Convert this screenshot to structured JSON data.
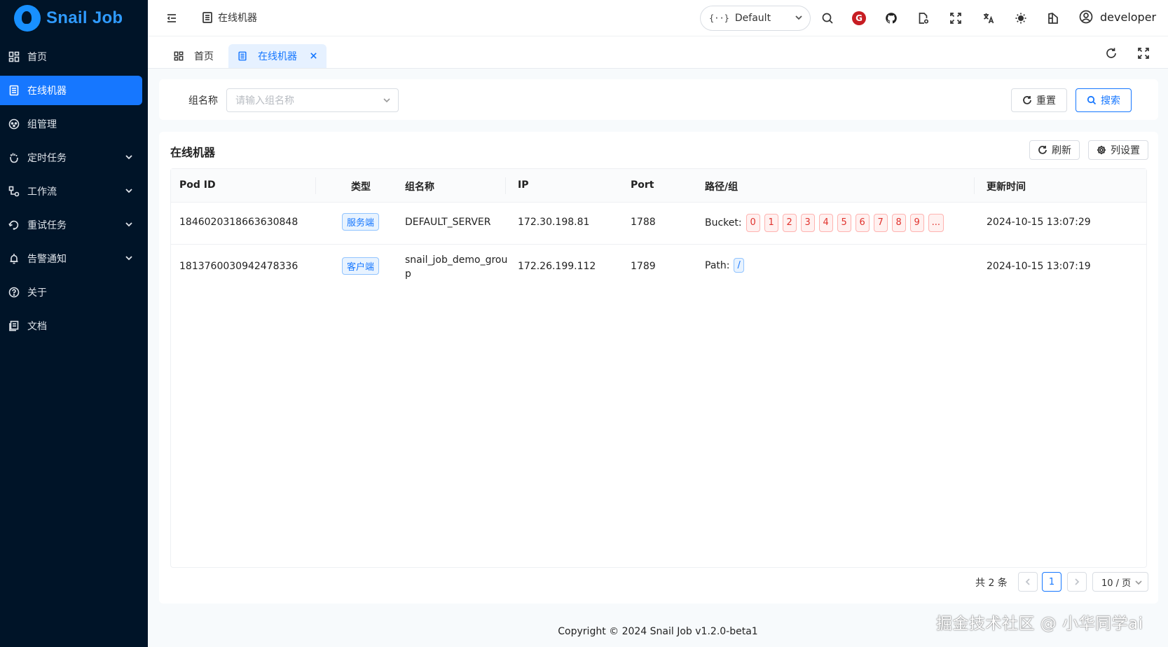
{
  "app": {
    "name": "Snail Job"
  },
  "sidebar": {
    "items": [
      {
        "label": "首页",
        "icon": "dashboard-icon",
        "active": false,
        "expandable": false
      },
      {
        "label": "在线机器",
        "icon": "server-icon",
        "active": true,
        "expandable": false
      },
      {
        "label": "组管理",
        "icon": "group-icon",
        "active": false,
        "expandable": false
      },
      {
        "label": "定时任务",
        "icon": "timer-icon",
        "active": false,
        "expandable": true
      },
      {
        "label": "工作流",
        "icon": "workflow-icon",
        "active": false,
        "expandable": true
      },
      {
        "label": "重试任务",
        "icon": "retry-icon",
        "active": false,
        "expandable": true
      },
      {
        "label": "告警通知",
        "icon": "bell-icon",
        "active": false,
        "expandable": true
      },
      {
        "label": "关于",
        "icon": "help-icon",
        "active": false,
        "expandable": false
      },
      {
        "label": "文档",
        "icon": "document-icon",
        "active": false,
        "expandable": false
      }
    ]
  },
  "header": {
    "breadcrumb": "在线机器",
    "namespace": "Default",
    "user": "developer",
    "gitee_letter": "G"
  },
  "tabs": [
    {
      "label": "首页",
      "active": false
    },
    {
      "label": "在线机器",
      "active": true
    }
  ],
  "search": {
    "group_label": "组名称",
    "group_placeholder": "请输入组名称",
    "reset_label": "重置",
    "search_label": "搜索"
  },
  "table": {
    "title": "在线机器",
    "refresh_label": "刷新",
    "column_settings_label": "列设置",
    "columns": [
      "Pod ID",
      "类型",
      "组名称",
      "IP",
      "Port",
      "路径/组",
      "更新时间"
    ],
    "rows": [
      {
        "pod_id": "1846020318663630848",
        "type": "服务端",
        "group": "DEFAULT_SERVER",
        "group_line2": "",
        "ip": "172.30.198.81",
        "port": "1788",
        "path_label": "Bucket:",
        "path_tags": [
          "0",
          "1",
          "2",
          "3",
          "4",
          "5",
          "6",
          "7",
          "8",
          "9",
          "..."
        ],
        "updated": "2024-10-15 13:07:29"
      },
      {
        "pod_id": "1813760030942478336",
        "type": "客户端",
        "group": "snail_job_demo_grou",
        "group_line2": "p",
        "ip": "172.26.199.112",
        "port": "1789",
        "path_label": "Path:",
        "path_tags": [
          "/"
        ],
        "updated": "2024-10-15 13:07:19"
      }
    ]
  },
  "pagination": {
    "total_text": "共 2 条",
    "current_page": "1",
    "page_size": "10 / 页"
  },
  "footer": {
    "copyright": "Copyright © 2024 Snail Job v1.2.0-beta1"
  },
  "watermark": "掘金技术社区 @ 小华同学ai",
  "colors": {
    "sidebar_bg": "#001428",
    "accent": "#1677ff",
    "tag_red": "#e0322d"
  }
}
